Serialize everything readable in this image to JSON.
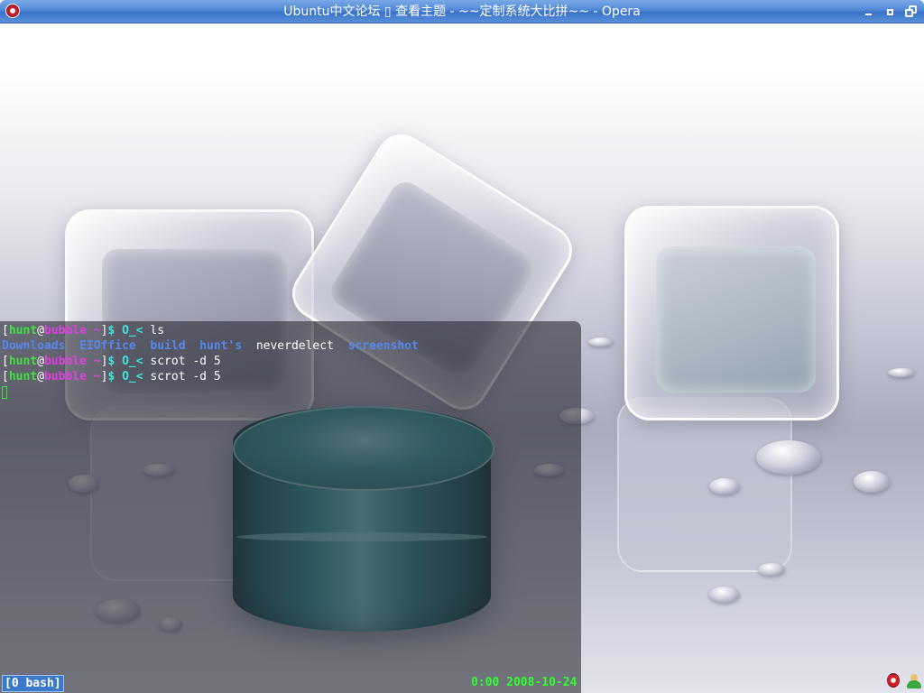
{
  "window": {
    "title": "Ubuntu中文论坛 \u0000 查看主题 - ~~定制系统大比拼~~ - Opera",
    "title_display": "Ubuntu中文论坛 ▯ 查看主题 - ~~定制系统大比拼~~ - Opera",
    "buttons": {
      "minimize": "minimize-icon",
      "maximize": "maximize-icon",
      "restore": "restore-icon"
    },
    "app_icon": "opera-icon",
    "accent": "#4f86d6"
  },
  "terminal": {
    "lines": [
      {
        "type": "prompt",
        "open": "[",
        "user": "hunt",
        "at": "@",
        "host": "bubble",
        "dir": " ~",
        "close": "]",
        "prompt": "$ O_<",
        "command": " ls"
      },
      {
        "type": "listing",
        "entries": [
          {
            "name": "Downloads",
            "kind": "dir"
          },
          {
            "name": "EIOffice",
            "kind": "dir"
          },
          {
            "name": "build",
            "kind": "dir"
          },
          {
            "name": "hunt's",
            "kind": "dir"
          },
          {
            "name": "neverdelect",
            "kind": "file"
          },
          {
            "name": "screenshot",
            "kind": "dir"
          }
        ]
      },
      {
        "type": "prompt",
        "open": "[",
        "user": "hunt",
        "at": "@",
        "host": "bubble",
        "dir": " ~",
        "close": "]",
        "prompt": "$ O_<",
        "command": " scrot -d 5"
      },
      {
        "type": "prompt",
        "open": "[",
        "user": "hunt",
        "at": "@",
        "host": "bubble",
        "dir": " ~",
        "close": "]",
        "prompt": "$ O_<",
        "command": " scrot -d 5"
      }
    ],
    "colors": {
      "user": "#40e040",
      "host": "#e040e0",
      "prompt": "#40e0e0",
      "directory": "#5588ee"
    }
  },
  "statusbar": {
    "window_label": "[0 bash]",
    "clock": "0:00 2008-10-24",
    "tray": {
      "opera": "opera-icon",
      "user": "user-icon"
    }
  }
}
